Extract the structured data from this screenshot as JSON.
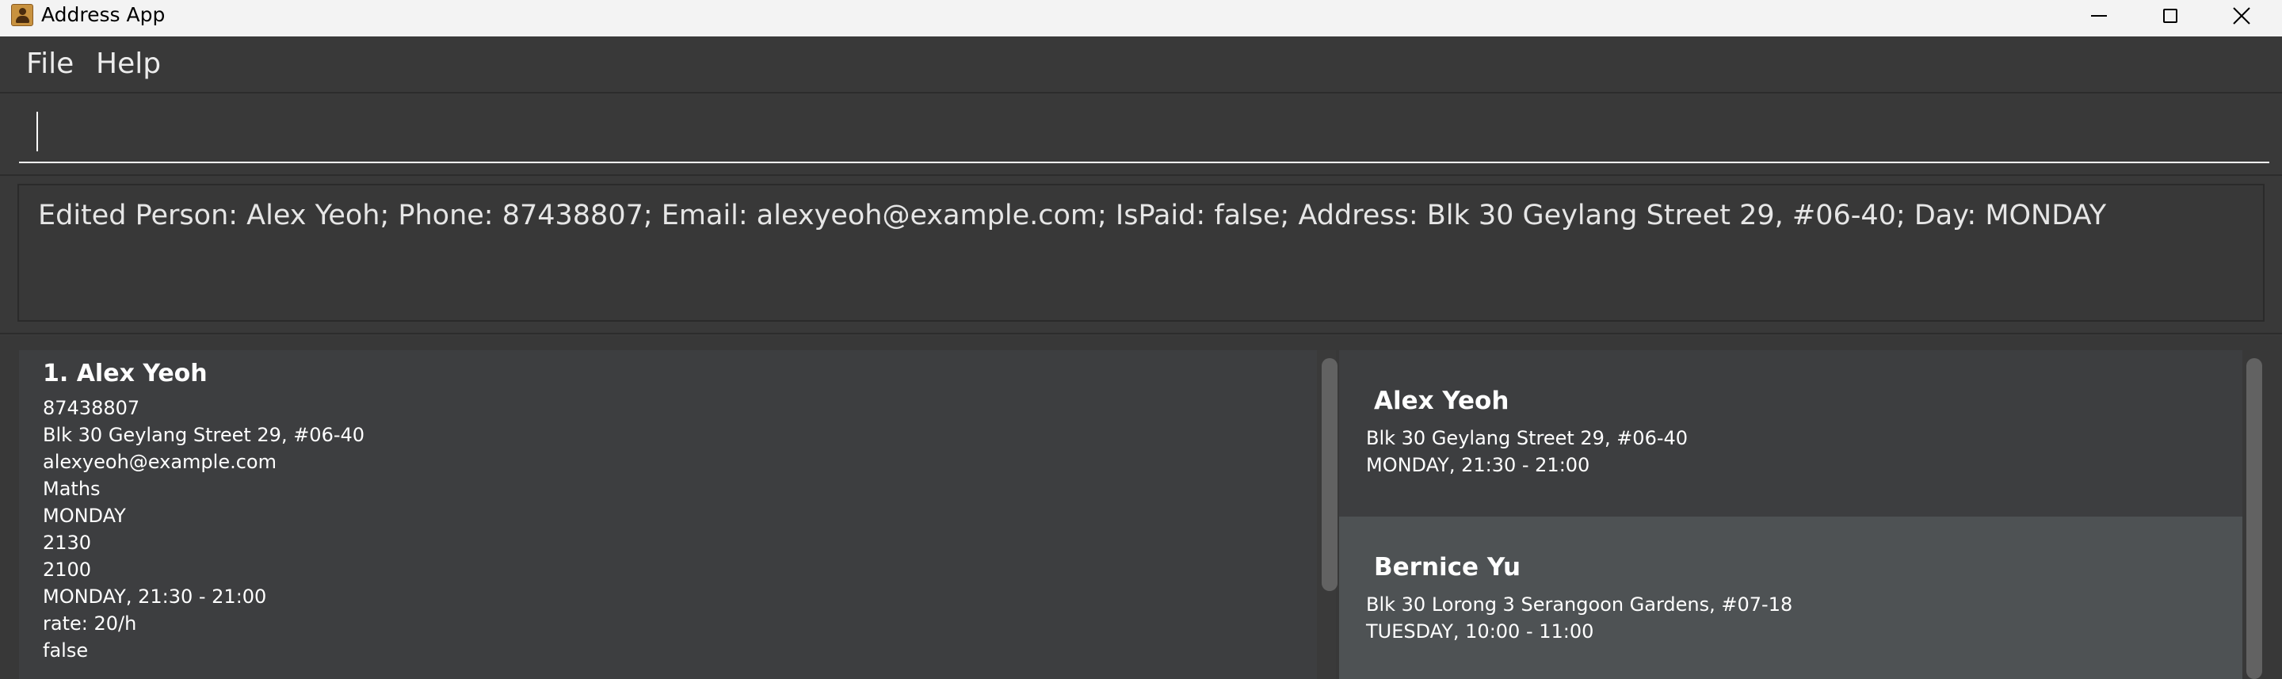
{
  "window": {
    "title": "Address App"
  },
  "menu": {
    "file": "File",
    "help": "Help"
  },
  "command": {
    "value": "",
    "placeholder": ""
  },
  "result": {
    "text": "Edited Person: Alex Yeoh; Phone: 87438807; Email: alexyeoh@example.com; IsPaid: false; Address: Blk 30 Geylang Street 29, #06-40; Day: MONDAY"
  },
  "person": {
    "name": "1.  Alex Yeoh",
    "lines": [
      "87438807",
      "Blk 30 Geylang Street 29, #06-40",
      "alexyeoh@example.com",
      "Maths",
      "MONDAY",
      "2130",
      "2100",
      "MONDAY, 21:30 - 21:00",
      "rate: 20/h",
      "false"
    ]
  },
  "schedule": [
    {
      "name": "Alex Yeoh",
      "address": "Blk 30 Geylang Street 29, #06-40",
      "time": "MONDAY, 21:30 - 21:00"
    },
    {
      "name": "Bernice Yu",
      "address": "Blk 30 Lorong 3 Serangoon Gardens, #07-18",
      "time": "TUESDAY, 10:00 - 11:00"
    }
  ],
  "colors": {
    "background": "#393939",
    "card": "#3d3e40",
    "selectedCard": "#4e5254",
    "text": "#ffffff"
  }
}
